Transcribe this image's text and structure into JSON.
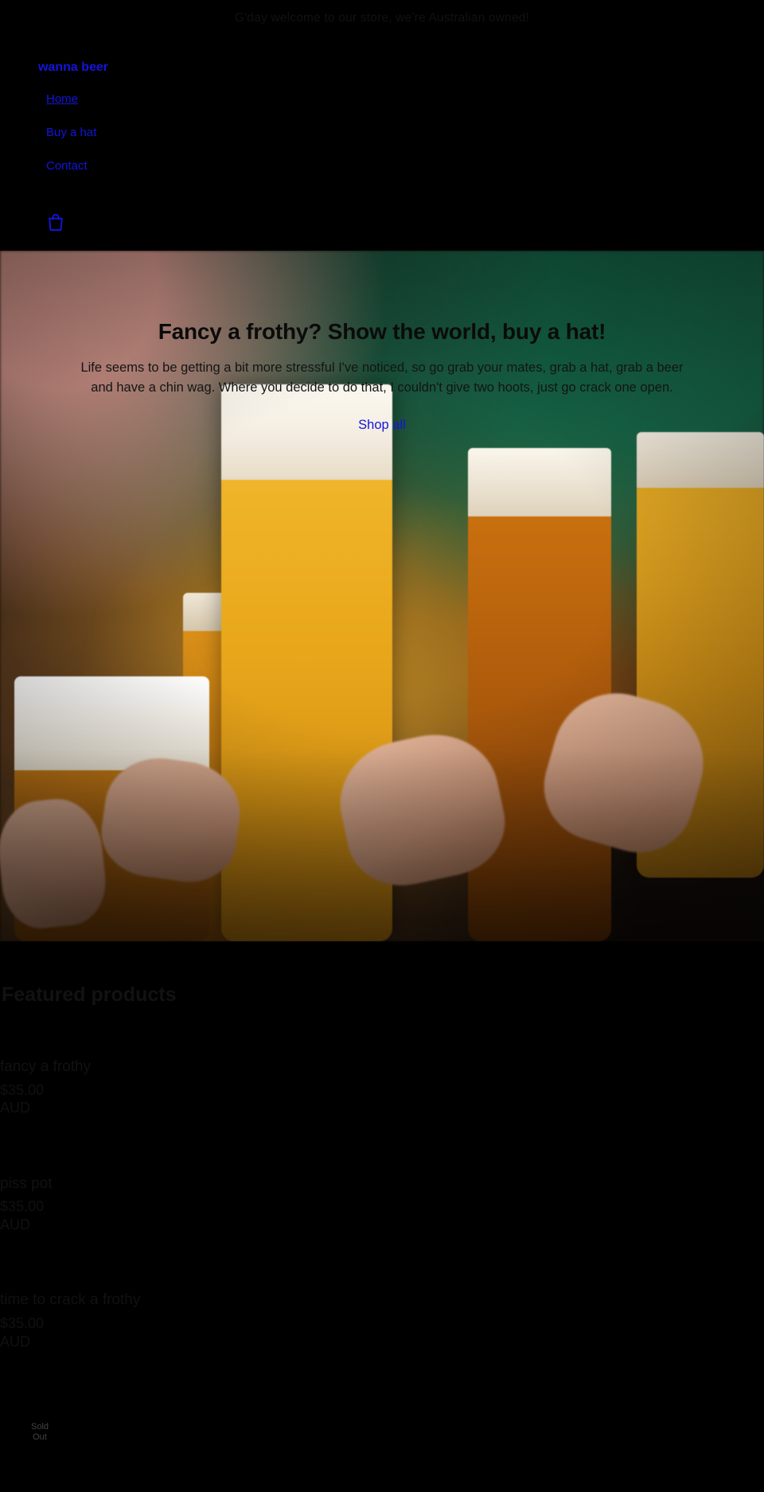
{
  "announcement": {
    "text": "G'day welcome to our store, we're Australian owned!"
  },
  "header": {
    "store_name": "wanna beer",
    "nav": [
      {
        "label": "Home",
        "active": true
      },
      {
        "label": "Buy a hat",
        "active": false
      },
      {
        "label": "Contact",
        "active": false
      }
    ],
    "cart": {
      "icon": "shopping-bag-icon",
      "label": "Cart"
    }
  },
  "hero": {
    "title": "Fancy a frothy? Show the world, buy a hat!",
    "body": "Life seems to be getting a bit more stressful I've noticed, so go grab your mates, grab a hat, grab a beer and have a chin wag. Where you decide to do that, I couldn't give two hoots, just go crack one open.",
    "cta_label": "Shop all",
    "image_alt": "Friends clinking full glasses of beer in a cheers"
  },
  "featured": {
    "title": "Featured products",
    "products": [
      {
        "title": "fancy a frothy",
        "price_amount": "$35.00",
        "price_currency": "AUD"
      },
      {
        "title": "piss pot",
        "price_amount": "$35.00",
        "price_currency": "AUD"
      },
      {
        "title": "time to crack a frothy",
        "price_amount": "$35.00",
        "price_currency": "AUD"
      }
    ]
  },
  "footer": {
    "badge_line1": "Sold",
    "badge_line2": "Out"
  },
  "colors": {
    "page_background": "#000000",
    "link": "#1414dd",
    "text_dark": "#111111"
  }
}
